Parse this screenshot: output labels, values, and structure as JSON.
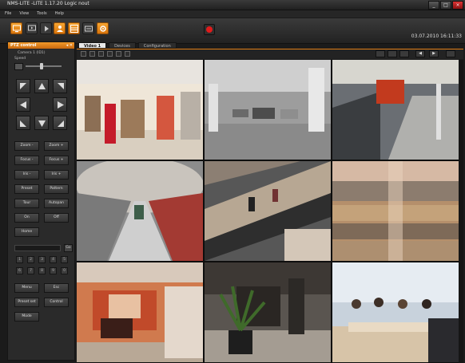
{
  "window": {
    "title": "NMS-LITE -LITE  1.17.20 Logic nout",
    "buttons": [
      "_",
      "□",
      "×"
    ]
  },
  "menu": {
    "items": [
      "File",
      "View",
      "Tools",
      "Help"
    ]
  },
  "toolbar": {
    "datetime": "03.07.2010 16:11:33"
  },
  "ptz": {
    "title": "PTZ control",
    "header_buttons": "◂ ✕",
    "camera": "Camera 1 (ID1)",
    "speed_label": "Speed",
    "speed_value": 0.45,
    "buttons": {
      "zoom_minus": "Zoom -",
      "zoom_plus": "Zoom +",
      "focus_minus": "Focus -",
      "focus_plus": "Focus +",
      "iris_minus": "Iris -",
      "iris_plus": "Iris +",
      "preset": "Preset",
      "pattern": "Pattern",
      "tour": "Tour",
      "autopan": "Autopan",
      "on": "On",
      "off": "Off",
      "home": "Home",
      "menu": "Menu",
      "esc": "Esc",
      "preset_set": "Preset set",
      "control": "Control",
      "mode": "Mode"
    },
    "go_label": "Go",
    "keypad": [
      "1",
      "2",
      "3",
      "4",
      "5",
      "6",
      "7",
      "8",
      "9",
      "0"
    ]
  },
  "tabs": [
    "Video 1",
    "Devices",
    "Configuration"
  ],
  "nav": [
    "◀",
    "▶"
  ],
  "colors": {
    "accent": "#e07d14",
    "record": "#e01b1b"
  },
  "cameras": [
    {
      "name": "camera-clothing-store"
    },
    {
      "name": "camera-parking-garage"
    },
    {
      "name": "camera-metro-platform"
    },
    {
      "name": "camera-metro-station"
    },
    {
      "name": "camera-mall-escalators"
    },
    {
      "name": "camera-shopping-mall"
    },
    {
      "name": "camera-meeting-room"
    },
    {
      "name": "camera-lobby-plant"
    },
    {
      "name": "camera-conference-room"
    }
  ]
}
